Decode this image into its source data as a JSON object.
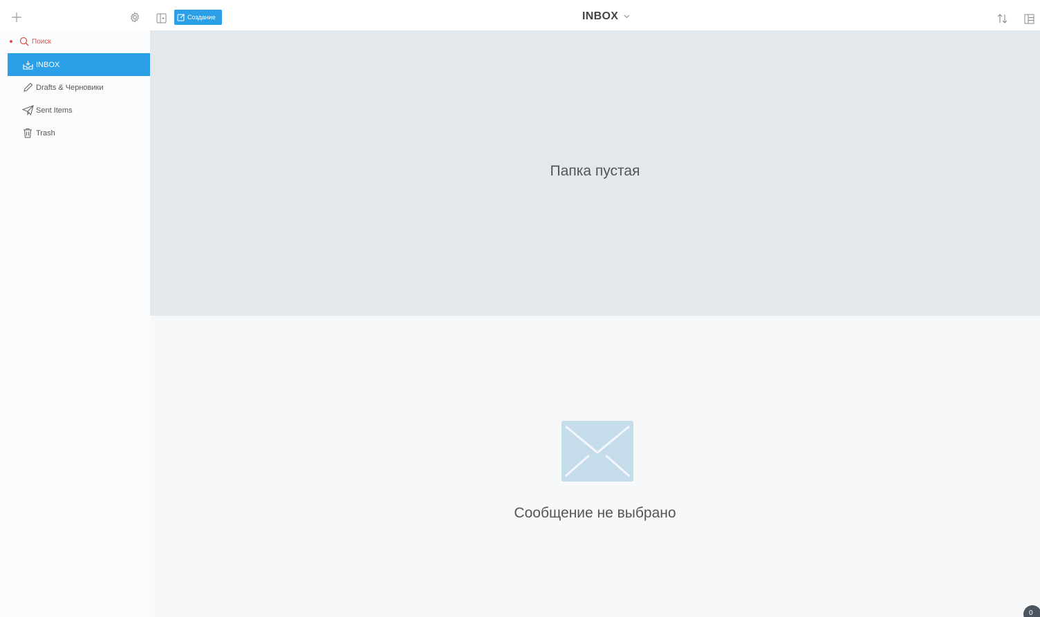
{
  "toolbar": {
    "compose_label": "Создание",
    "folder_title": "INBOX"
  },
  "sidebar": {
    "search_label": "Поиск",
    "items": [
      {
        "label": "INBOX",
        "icon": "inbox-icon",
        "active": true
      },
      {
        "label": "Drafts & Черновики",
        "icon": "pencil-icon",
        "active": false
      },
      {
        "label": "Sent Items",
        "icon": "paper-plane-icon",
        "active": false
      },
      {
        "label": "Trash",
        "icon": "trash-icon",
        "active": false
      }
    ]
  },
  "list": {
    "empty_text": "Папка пустая"
  },
  "preview": {
    "empty_text": "Сообщение не выбрано"
  },
  "badge": {
    "count": "0"
  },
  "colors": {
    "accent": "#2ba0e6",
    "search_red": "#d9534f",
    "list_bg": "#e3e8ec",
    "preview_bg": "#f6f8fa"
  }
}
